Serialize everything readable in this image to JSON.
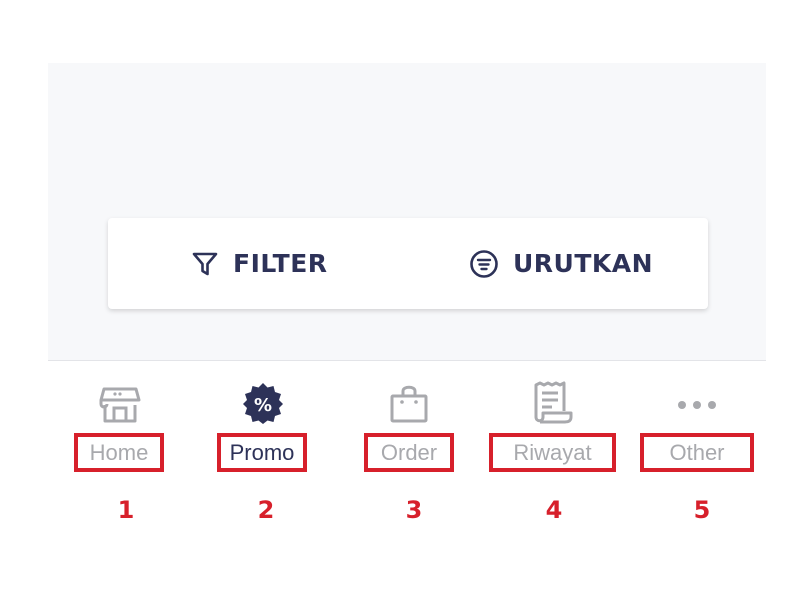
{
  "toolbar": {
    "filter_label": "FILTER",
    "filter_icon": "funnel-icon",
    "sort_label": "URUTKAN",
    "sort_icon": "sort-lines-icon"
  },
  "bottom_nav": {
    "items": [
      {
        "label": "Home",
        "icon": "store-icon",
        "active": false
      },
      {
        "label": "Promo",
        "icon": "percent-badge-icon",
        "active": true
      },
      {
        "label": "Order",
        "icon": "shopping-bag-icon",
        "active": false
      },
      {
        "label": "Riwayat",
        "icon": "receipt-icon",
        "active": false
      },
      {
        "label": "Other",
        "icon": "more-dots-icon",
        "active": false
      }
    ]
  },
  "markers": [
    "1",
    "2",
    "3",
    "4",
    "5"
  ],
  "colors": {
    "primary": "#2d3258",
    "inactive": "#a8a9ad",
    "annotation": "#d7202b",
    "panel_bg": "#f7f8fa"
  }
}
